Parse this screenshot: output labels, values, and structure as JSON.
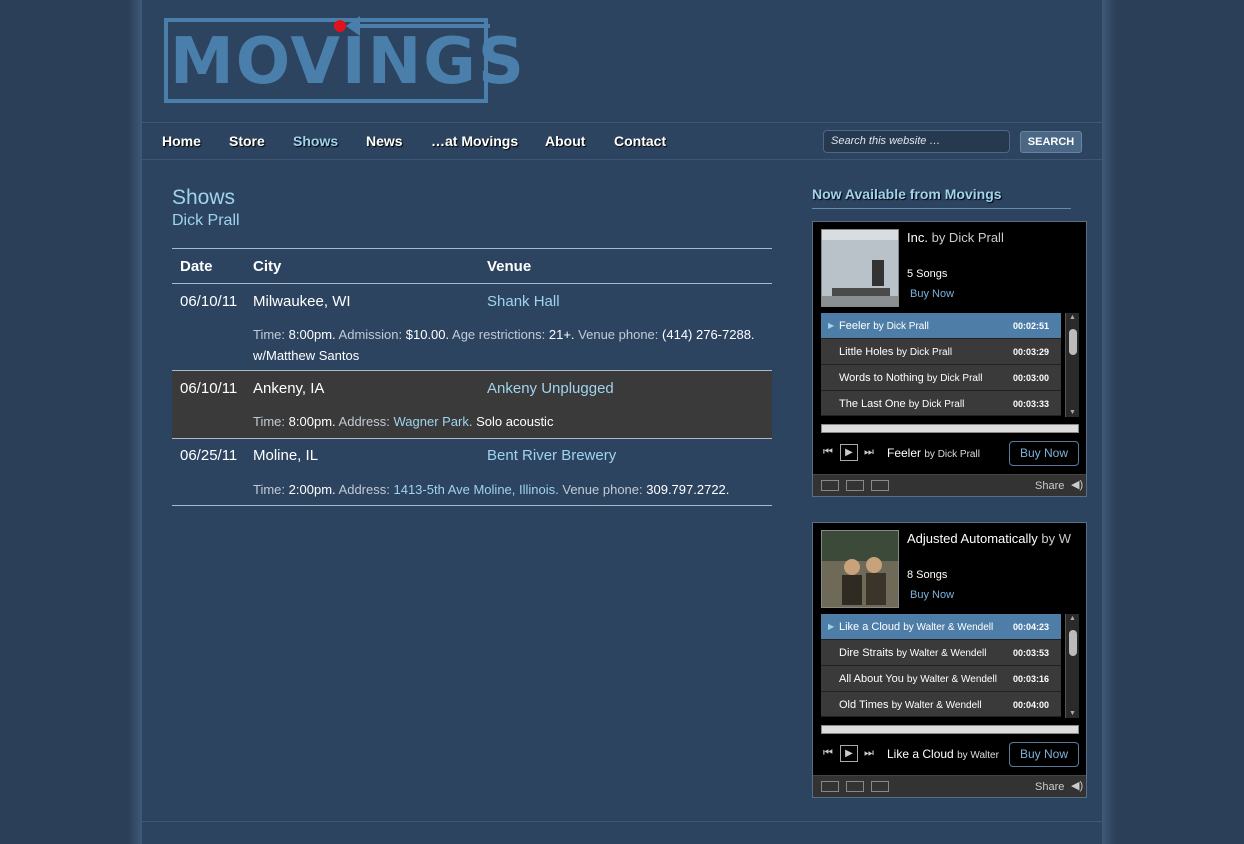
{
  "logo": {
    "text": "MOVINGS"
  },
  "nav": {
    "items": [
      {
        "label": "Home",
        "active": false
      },
      {
        "label": "Store",
        "active": false
      },
      {
        "label": "Shows",
        "active": true
      },
      {
        "label": "News",
        "active": false
      },
      {
        "label": "…at Movings",
        "active": false
      },
      {
        "label": "About",
        "active": false
      },
      {
        "label": "Contact",
        "active": false
      }
    ],
    "search_placeholder": "Search this website …",
    "search_button": "SEARCH"
  },
  "main": {
    "title": "Shows",
    "subtitle": "Dick Prall",
    "columns": [
      "Date",
      "City",
      "Venue"
    ],
    "shows": [
      {
        "date": "06/10/11",
        "city": "Milwaukee, WI",
        "venue": "Shank Hall",
        "time_label": "Time:",
        "time": "8:00pm.",
        "admission_label": "Admission:",
        "admission": "$10.00.",
        "age_label": "Age restrictions:",
        "age": "21+.",
        "phone_label": "Venue phone:",
        "phone": "(414) 276-7288.",
        "note": "w/Matthew Santos"
      },
      {
        "date": "06/10/11",
        "city": "Ankeny, IA",
        "venue": "Ankeny Unplugged",
        "time_label": "Time:",
        "time": "8:00pm.",
        "address_label": "Address:",
        "address": "Wagner Park",
        "note": "Solo acoustic"
      },
      {
        "date": "06/25/11",
        "city": "Moline, IL",
        "venue": "Bent River Brewery",
        "time_label": "Time:",
        "time": "2:00pm.",
        "address_label": "Address:",
        "address": "1413-5th Ave Moline, Illinois",
        "phone_label": "Venue phone:",
        "phone": "309.797.2722."
      }
    ]
  },
  "sidebar": {
    "title": "Now Available from Movings",
    "players": [
      {
        "album": "Inc.",
        "by": "by Dick Prall",
        "songs": "5 Songs",
        "buy_link": "Buy Now",
        "tracks": [
          {
            "title": "Feeler",
            "by": "by Dick Prall",
            "duration": "00:02:51",
            "active": true
          },
          {
            "title": "Little Holes",
            "by": "by Dick Prall",
            "duration": "00:03:29",
            "active": false
          },
          {
            "title": "Words to Nothing",
            "by": "by Dick Prall",
            "duration": "00:03:00",
            "active": false
          },
          {
            "title": "The Last One",
            "by": "by Dick Prall",
            "duration": "00:03:33",
            "active": false
          }
        ],
        "now_playing": "Feeler",
        "now_playing_by": "by Dick Prall",
        "buy_button": "Buy Now",
        "share": "Share"
      },
      {
        "album": "Adjusted Automatically",
        "by": "by W",
        "songs": "8 Songs",
        "buy_link": "Buy Now",
        "tracks": [
          {
            "title": "Like a Cloud",
            "by": "by Walter & Wendell",
            "duration": "00:04:23",
            "active": true
          },
          {
            "title": "Dire Straits",
            "by": "by Walter & Wendell",
            "duration": "00:03:53",
            "active": false
          },
          {
            "title": "All About You",
            "by": "by Walter & Wendell",
            "duration": "00:03:16",
            "active": false
          },
          {
            "title": "Old Times",
            "by": "by Walter & Wendell",
            "duration": "00:04:00",
            "active": false
          }
        ],
        "now_playing": "Like a Cloud",
        "now_playing_by": "by Walter",
        "buy_button": "Buy Now",
        "share": "Share"
      }
    ]
  }
}
